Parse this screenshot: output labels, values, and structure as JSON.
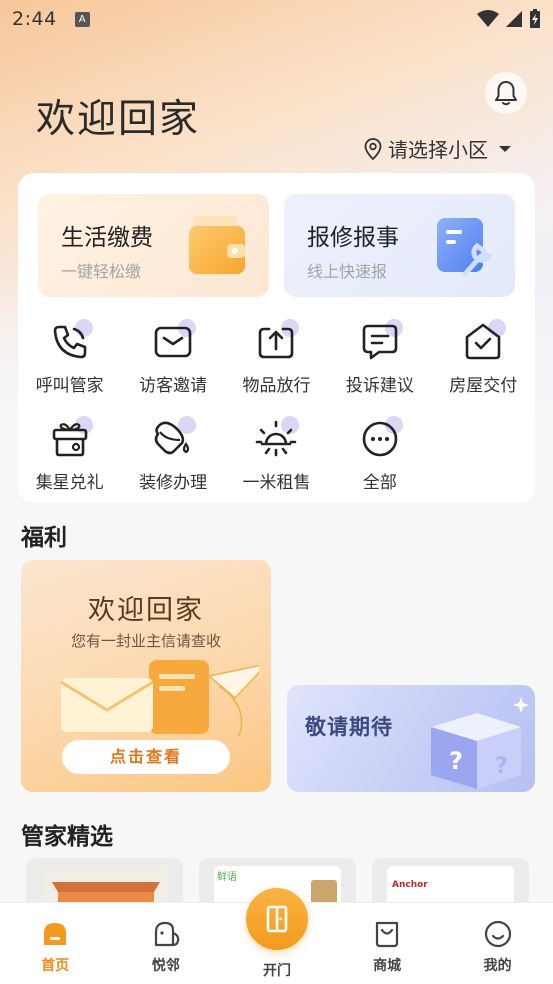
{
  "status_bar": {
    "time": "2:44",
    "notif_letter": "A"
  },
  "header": {
    "welcome": "欢迎回家",
    "community": "请选择小区"
  },
  "top_cards": [
    {
      "title": "生活缴费",
      "subtitle": "一键轻松缴"
    },
    {
      "title": "报修报事",
      "subtitle": "线上快速报"
    }
  ],
  "services": [
    {
      "label": "呼叫管家",
      "icon": "phone-icon"
    },
    {
      "label": "访客邀请",
      "icon": "mail-icon"
    },
    {
      "label": "物品放行",
      "icon": "upload-box-icon"
    },
    {
      "label": "投诉建议",
      "icon": "chat-icon"
    },
    {
      "label": "房屋交付",
      "icon": "house-check-icon"
    },
    {
      "label": "集星兑礼",
      "icon": "gift-icon"
    },
    {
      "label": "装修办理",
      "icon": "paint-bucket-icon"
    },
    {
      "label": "一米租售",
      "icon": "sun-icon"
    },
    {
      "label": "全部",
      "icon": "more-icon"
    }
  ],
  "welfare": {
    "section_title": "福利",
    "left_title": "欢迎回家",
    "left_subtitle": "您有一封业主信请查收",
    "left_button": "点击查看",
    "right_title": "敬请期待"
  },
  "featured": {
    "section_title": "管家精选",
    "brand_1": "鲜语",
    "brand_2": "Anchor"
  },
  "bottom_nav": [
    {
      "label": "首页",
      "icon": "home-icon",
      "active": true
    },
    {
      "label": "悦邻",
      "icon": "neighbor-icon",
      "active": false
    },
    {
      "label": "开门",
      "icon": "door-icon",
      "active": false
    },
    {
      "label": "商城",
      "icon": "shop-bag-icon",
      "active": false
    },
    {
      "label": "我的",
      "icon": "profile-icon",
      "active": false
    }
  ],
  "colors": {
    "accent": "#f29a1e",
    "active_text": "#f2891f",
    "purple_dot": "#ddd5f4"
  }
}
